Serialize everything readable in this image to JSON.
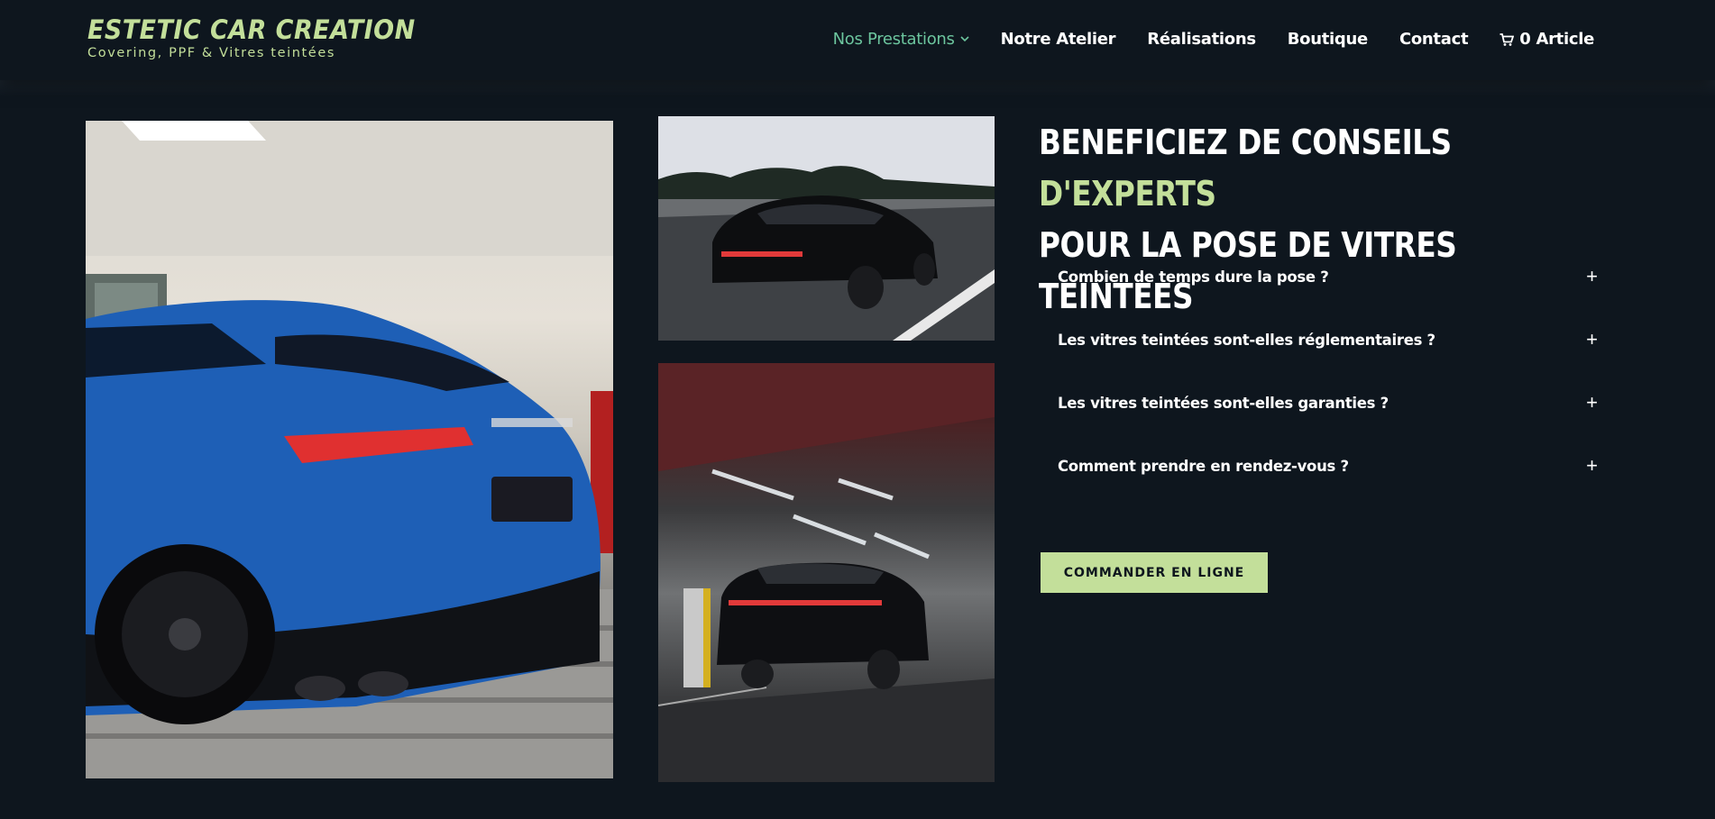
{
  "brand": {
    "title": "ESTETIC CAR CREATION",
    "subtitle": "Covering, PPF & Vitres teintées",
    "accent_color": "#c3df9a"
  },
  "nav": {
    "items": [
      {
        "label": "Nos Prestations",
        "active": true,
        "has_dropdown": true
      },
      {
        "label": "Notre Atelier"
      },
      {
        "label": "Réalisations"
      },
      {
        "label": "Boutique"
      },
      {
        "label": "Contact"
      },
      {
        "label": "0 Article",
        "icon": "cart-icon"
      }
    ],
    "active_color": "#6cc59e"
  },
  "heading": {
    "part1": "BENEFICIEZ DE CONSEILS ",
    "accent": "D'EXPERTS",
    "part2": "POUR LA POSE DE VITRES TEINTEES"
  },
  "faq": [
    {
      "question": "Combien de temps dure la pose ?"
    },
    {
      "question": "Les vitres teintées sont-elles réglementaires ?"
    },
    {
      "question": "Les vitres teintées sont-elles garanties ?"
    },
    {
      "question": "Comment prendre en rendez-vous ?"
    }
  ],
  "faq_toggle_symbol": "+",
  "cta": {
    "label": "COMMANDER EN LIGNE"
  },
  "colors": {
    "background": "#0e161e",
    "cta_bg": "#c3df9a"
  }
}
